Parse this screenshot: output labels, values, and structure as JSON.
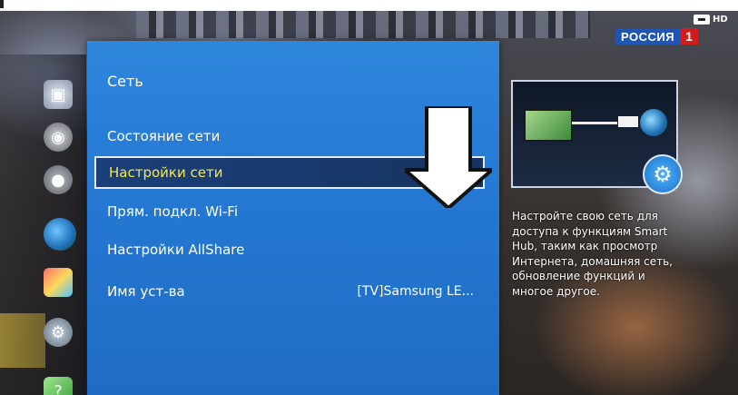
{
  "channel": {
    "name": "РОССИЯ",
    "number": "1",
    "badge": "HD"
  },
  "panel": {
    "title": "Сеть"
  },
  "menu": [
    {
      "label": "Состояние сети",
      "value": ""
    },
    {
      "label": "Настройки сети",
      "value": "",
      "selected": true
    },
    {
      "label": "Прям. подкл. Wi-Fi",
      "value": ""
    },
    {
      "label": "Настройки AllShare",
      "value": ""
    },
    {
      "label": "Имя уст-ва",
      "value": "[TV]Samsung LE..."
    }
  ],
  "description": "Настройте свою сеть для доступа к функциям Smart Hub, таким как просмотр Интернета, домашняя сеть, обновление функций и многое другое.",
  "sidebar": {
    "icons": [
      "picture-icon",
      "sound-icon",
      "broadcast-icon",
      "network-globe-icon",
      "smart-hub-cube-icon",
      "settings-gear-icon",
      "support-icon"
    ]
  },
  "colors": {
    "panel": "#2478d2",
    "highlight_text": "#f5e84a",
    "selected_bg": "#1b3f7a"
  }
}
